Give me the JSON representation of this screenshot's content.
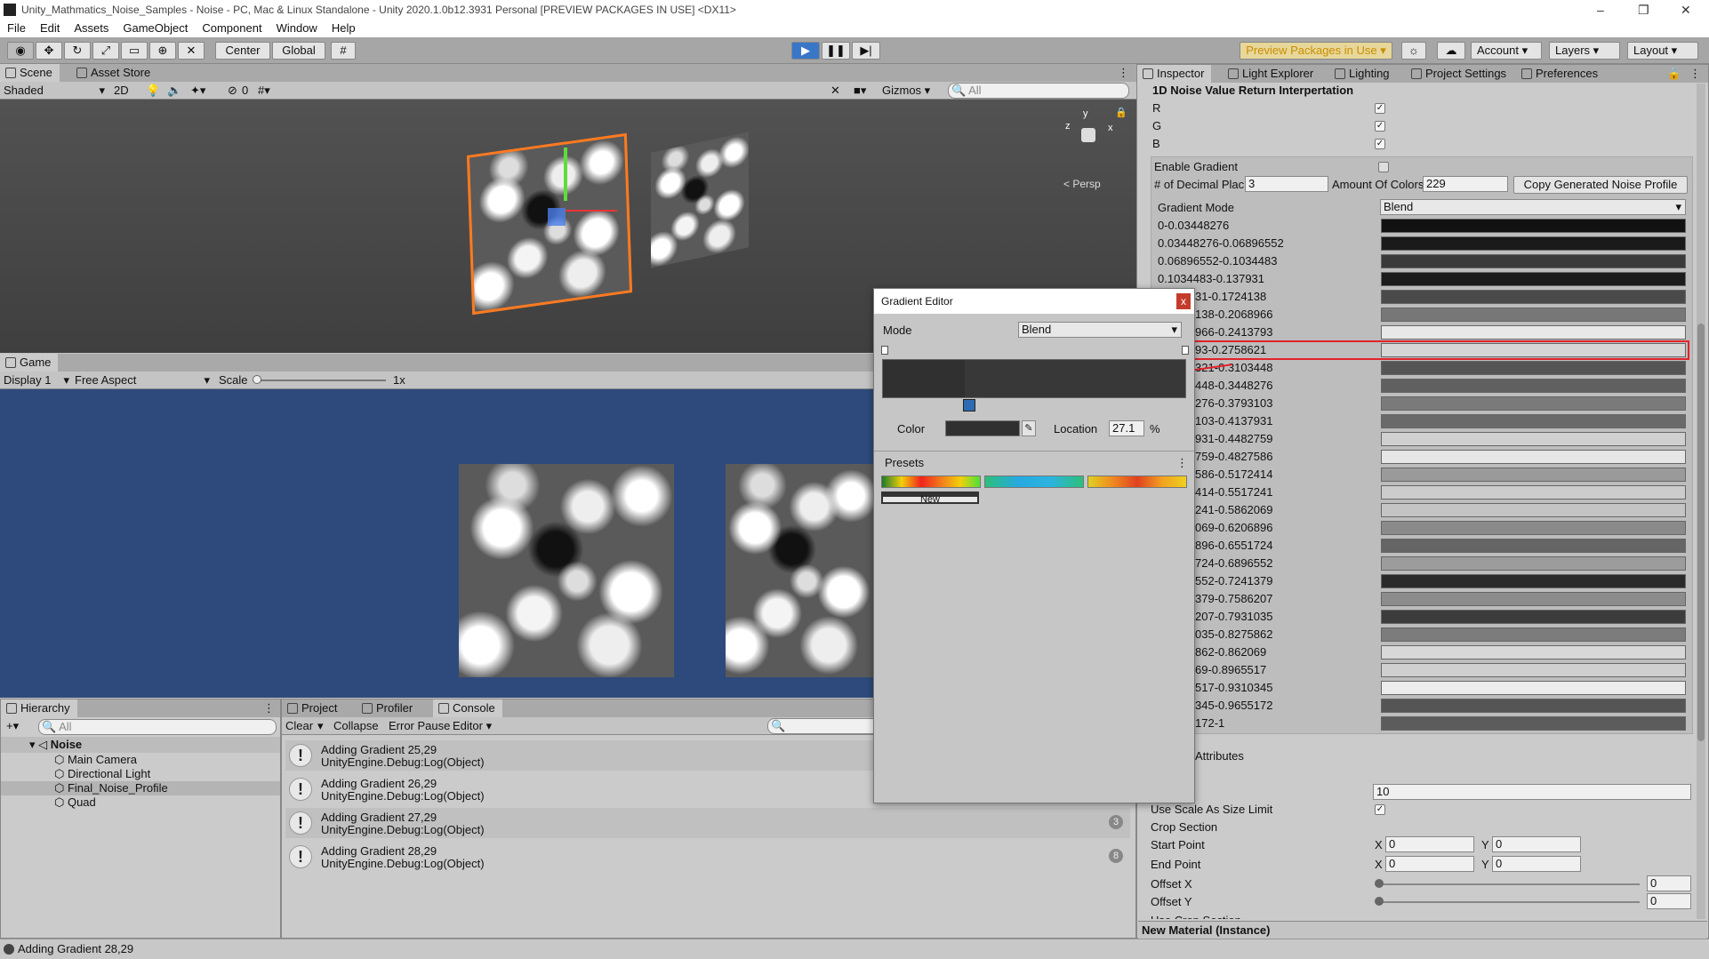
{
  "window": {
    "title": "Unity_Mathmatics_Noise_Samples - Noise - PC, Mac & Linux Standalone - Unity 2020.1.0b12.3931 Personal [PREVIEW PACKAGES IN USE] <DX11>",
    "minimize": "–",
    "restore": "❐",
    "close": "✕"
  },
  "menu": [
    "File",
    "Edit",
    "Assets",
    "GameObject",
    "Component",
    "Window",
    "Help"
  ],
  "toolbar": {
    "center": "Center",
    "global": "Global",
    "preview_packages": "Preview Packages in Use",
    "account": "Account",
    "layers": "Layers",
    "layout": "Layout"
  },
  "scene": {
    "tab_scene": "Scene",
    "tab_asset_store": "Asset Store",
    "shading": "Shaded",
    "mode_2d": "2D",
    "hidden_count": "0",
    "gizmos": "Gizmos",
    "search_placeholder": "All",
    "persp": "< Persp",
    "axis_y": "y",
    "axis_x": "x",
    "axis_z": "z"
  },
  "game": {
    "tab": "Game",
    "display": "Display 1",
    "aspect": "Free Aspect",
    "scale_label": "Scale",
    "scale_value": "1x"
  },
  "hierarchy": {
    "tab": "Hierarchy",
    "search_placeholder": "All",
    "root": "Noise",
    "items": [
      "Main Camera",
      "Directional Light",
      "Final_Noise_Profile",
      "Quad"
    ]
  },
  "console": {
    "tab_project": "Project",
    "tab_profiler": "Profiler",
    "tab_console": "Console",
    "clear": "Clear",
    "collapse": "Collapse",
    "error_pause": "Error Pause",
    "editor": "Editor",
    "entries": [
      {
        "line1": "Adding Gradient 25,29",
        "line2": "UnityEngine.Debug:Log(Object)",
        "count": ""
      },
      {
        "line1": "Adding Gradient 26,29",
        "line2": "UnityEngine.Debug:Log(Object)",
        "count": ""
      },
      {
        "line1": "Adding Gradient 27,29",
        "line2": "UnityEngine.Debug:Log(Object)",
        "count": "3"
      },
      {
        "line1": "Adding Gradient 28,29",
        "line2": "UnityEngine.Debug:Log(Object)",
        "count": "8"
      }
    ]
  },
  "status": {
    "text": "Adding Gradient 28,29"
  },
  "inspector": {
    "tab_inspector": "Inspector",
    "tab_light_explorer": "Light Explorer",
    "tab_lighting": "Lighting",
    "tab_project_settings": "Project Settings",
    "tab_preferences": "Preferences",
    "section_title": "1D Noise Value Return Interpertation",
    "r": "R",
    "g": "G",
    "b": "B",
    "enable_gradient": "Enable Gradient",
    "decimal_label": "# of Decimal Plac",
    "decimal_value": "3",
    "amount_label": "Amount Of Colors",
    "amount_value": "229",
    "copy_button": "Copy Generated Noise Profile",
    "gradient_mode_label": "Gradient Mode",
    "gradient_mode_value": "Blend",
    "ranges": [
      "0-0.03448276",
      "0.03448276-0.06896552",
      "0.06896552-0.1034483",
      "0.1034483-0.137931",
      "31-0.1724138",
      "138-0.2068966",
      "966-0.2413793",
      "93-0.2758621",
      "321-0.3103448",
      "448-0.3448276",
      "276-0.3793103",
      "103-0.4137931",
      "931-0.4482759",
      "759-0.4827586",
      "586-0.5172414",
      "414-0.5517241",
      "241-0.5862069",
      "069-0.6206896",
      "896-0.6551724",
      "724-0.6896552",
      "552-0.7241379",
      "379-0.7586207",
      "207-0.7931035",
      "035-0.8275862",
      "862-0.862069",
      "69-0.8965517",
      "517-0.9310345",
      "345-0.9655172",
      "172-1"
    ],
    "swatch_colors": [
      "#111111",
      "#1a1a1a",
      "#3a3a3a",
      "#1c1c1c",
      "#4a4a4a",
      "#777777",
      "#e8e8e8",
      "#d6d6d6",
      "#555555",
      "#606060",
      "#7a7a7a",
      "#6a6a6a",
      "#d0d0d0",
      "#e6e6e6",
      "#9a9a9a",
      "#cccccc",
      "#c4c4c4",
      "#8a8a8a",
      "#656565",
      "#9c9c9c",
      "#2a2a2a",
      "#8c8c8c",
      "#3c3c3c",
      "#7c7c7c",
      "#d8d8d8",
      "#cfcfcf",
      "#ececec",
      "#555555",
      "#5c5c5c"
    ],
    "attributes": "Attributes",
    "scale_value": "10",
    "use_scale": "Use Scale As Size Limit",
    "crop_section": "Crop Section",
    "start_point": "Start Point",
    "end_point": "End Point",
    "x": "X",
    "y": "Y",
    "zero": "0",
    "offset_x": "Offset X",
    "offset_y": "Offset Y",
    "use_crop": "Use Crop Section",
    "material": "New Material (Instance)"
  },
  "gradient_editor": {
    "title": "Gradient Editor",
    "close": "x",
    "mode_label": "Mode",
    "mode_value": "Blend",
    "color_label": "Color",
    "location_label": "Location",
    "location_value": "27.1",
    "percent": "%",
    "presets": "Presets",
    "new_button": "New"
  }
}
